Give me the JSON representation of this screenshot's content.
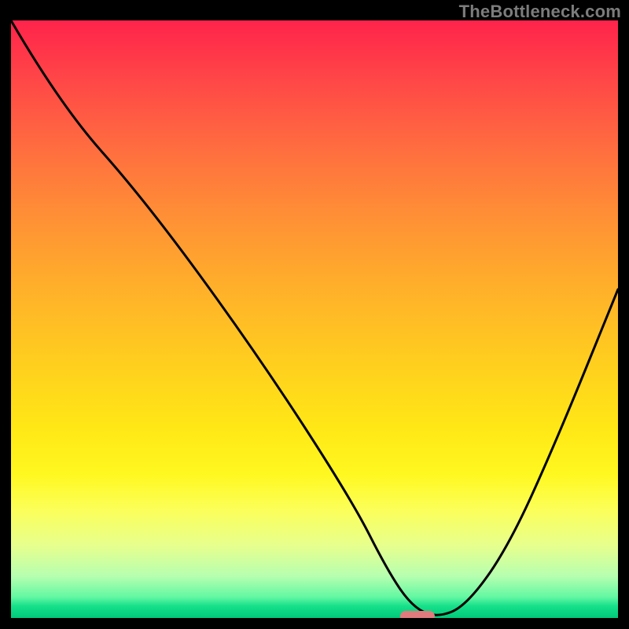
{
  "watermark": "TheBottleneck.com",
  "chart_data": {
    "type": "line",
    "title": "",
    "xlabel": "",
    "ylabel": "",
    "xlim": [
      0,
      100
    ],
    "ylim": [
      0,
      100
    ],
    "series": [
      {
        "name": "bottleneck-curve",
        "x": [
          0,
          8,
          22,
          40,
          56,
          62,
          66,
          70,
          75,
          82,
          90,
          100
        ],
        "y": [
          100,
          86,
          70,
          45,
          20,
          8,
          2,
          0,
          2,
          12,
          30,
          55
        ]
      }
    ],
    "marker": {
      "x": 67,
      "y": 0
    },
    "background": "vertical-gradient red→orange→yellow→green",
    "grid": false
  },
  "colors": {
    "curve": "#000000",
    "marker": "#e17a7d",
    "frame": "#000000",
    "watermark": "#7c7c7c"
  }
}
